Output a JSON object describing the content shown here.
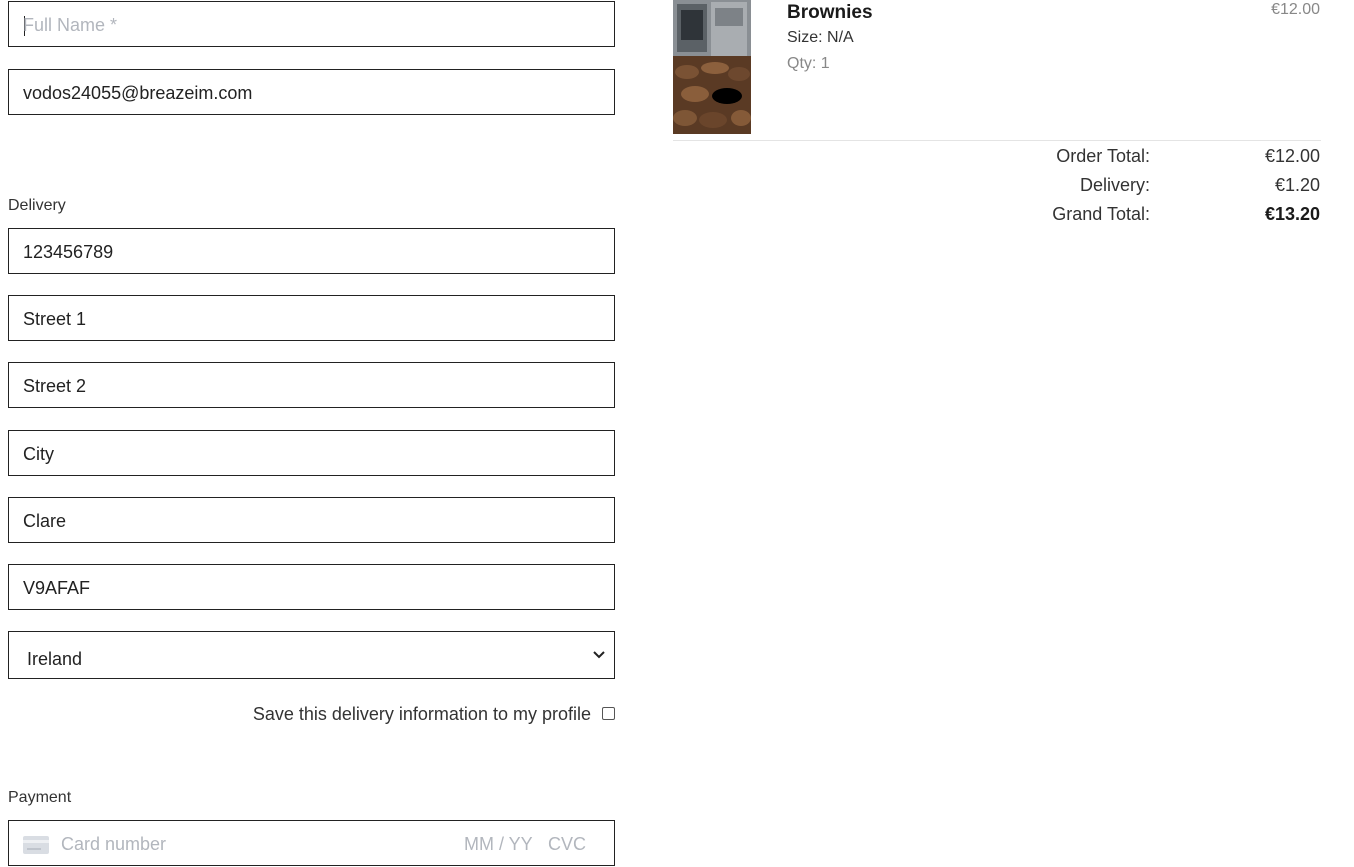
{
  "form": {
    "full_name_placeholder": "Full Name *",
    "email_value": "vodos24055@breazeim.com",
    "delivery_heading": "Delivery",
    "phone_value": "123456789",
    "street1_value": "Street 1",
    "street2_value": "Street 2",
    "city_value": "City",
    "county_value": "Clare",
    "postcode_value": "V9AFAF",
    "country_value": "Ireland",
    "save_info_label": "Save this delivery information to my profile",
    "payment_heading": "Payment",
    "card_number_placeholder": "Card number",
    "card_expiry_placeholder": "MM / YY",
    "card_cvc_placeholder": "CVC"
  },
  "summary": {
    "item": {
      "name": "Brownies",
      "size": "Size: N/A",
      "qty": "Qty: 1",
      "price": "€12.00",
      "image": "brownies-tray-photo"
    },
    "order_total_label": "Order Total:",
    "order_total_value": "€12.00",
    "delivery_label": "Delivery:",
    "delivery_value": "€1.20",
    "grand_total_label": "Grand Total:",
    "grand_total_value": "€13.20"
  },
  "colors": {
    "border": "#222222",
    "placeholder": "#b2b6bd",
    "muted": "#888888"
  }
}
